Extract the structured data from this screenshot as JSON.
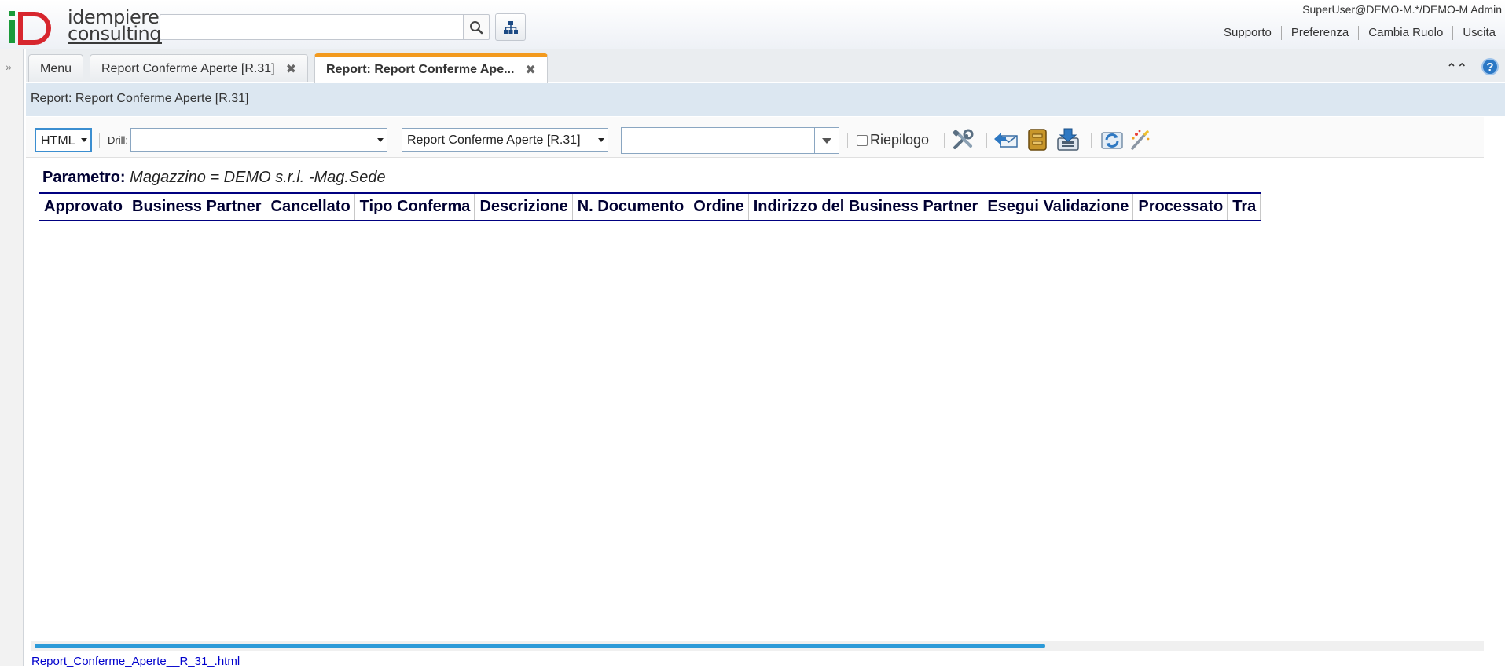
{
  "header": {
    "logo_text": "idempiere consulting",
    "search_placeholder": "",
    "user_info": "SuperUser@DEMO-M.*/DEMO-M Admin",
    "links": [
      "Supporto",
      "Preferenza",
      "Cambia Ruolo",
      "Uscita"
    ]
  },
  "tabs": [
    {
      "label": "Menu",
      "closable": false
    },
    {
      "label": "Report Conferme Aperte [R.31]",
      "closable": true
    },
    {
      "label": "Report: Report Conferme Ape...",
      "closable": true,
      "selected": true
    }
  ],
  "window_title": "Report: Report Conferme Aperte [R.31]",
  "toolbar": {
    "format_value": "HTML",
    "drill_label": "Drill:",
    "drill_value": "",
    "print_format_value": "Report Conferme Aperte [R.31]",
    "search_value": "",
    "summary_label": "Riepilogo",
    "icons": [
      "customize-icon",
      "send-mail-icon",
      "archive-icon",
      "export-icon",
      "refresh-icon",
      "wizard-icon"
    ]
  },
  "report": {
    "param_label": "Parametro:",
    "param_value": "Magazzino = DEMO s.r.l. -Mag.Sede",
    "columns": [
      "Approvato",
      "Business Partner",
      "Cancellato",
      "Tipo Conferma",
      "Descrizione",
      "N. Documento",
      "Ordine",
      "Indirizzo del Business Partner",
      "Esegui Validazione",
      "Processato",
      "Tra"
    ]
  },
  "footer": {
    "file_link": "Report_Conferme_Aperte__R_31_.html"
  },
  "colors": {
    "accent_tab": "#f39a1e",
    "header_text": "#000032",
    "table_rule": "#000080",
    "scroll_thumb": "#2c9ad8"
  }
}
